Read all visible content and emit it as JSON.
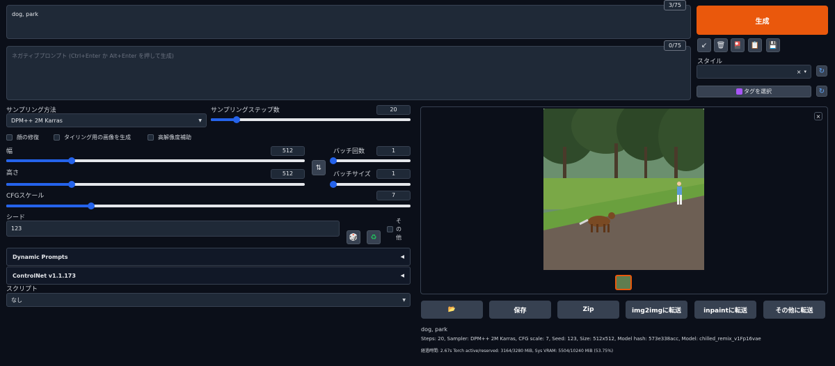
{
  "prompt": {
    "value": "dog, park",
    "counter": "3/75"
  },
  "negative_prompt": {
    "placeholder": "ネガティブプロンプト (Ctrl+Enter か Alt+Enter を押して生成)",
    "counter": "0/75"
  },
  "generate": {
    "label": "生成"
  },
  "tools": {
    "icons": [
      "arrow-down-left-icon",
      "trash-icon",
      "red-flag-icon",
      "clipboard-icon",
      "save-icon"
    ],
    "glyphs": [
      "↙",
      "🗑",
      "🎴",
      "📋",
      "💾"
    ]
  },
  "style": {
    "label": "スタイル",
    "clear": "×",
    "arrow": "▾",
    "refresh": "↻"
  },
  "tag_select": {
    "label": "タグを選択",
    "refresh": "↻"
  },
  "sampling": {
    "method_label": "サンプリング方法",
    "method_value": "DPM++ 2M Karras",
    "steps_label": "サンプリングステップ数",
    "steps_value": "20",
    "steps_frac": 0.13
  },
  "checkboxes": {
    "face_fix": "顔の修復",
    "tiling": "タイリング用の画像を生成",
    "hires": "高解像度補助"
  },
  "width": {
    "label": "幅",
    "value": "512",
    "frac": 0.22
  },
  "height": {
    "label": "高さ",
    "value": "512",
    "frac": 0.22
  },
  "swap": {
    "glyph": "⇅"
  },
  "batch_count": {
    "label": "バッチ回数",
    "value": "1",
    "frac": 0.0
  },
  "batch_size": {
    "label": "バッチサイズ",
    "value": "1",
    "frac": 0.0
  },
  "cfg": {
    "label": "CFGスケール",
    "value": "7",
    "frac": 0.21
  },
  "seed": {
    "label": "シード",
    "value": "123",
    "dice": "🎲",
    "recycle": "♻",
    "other_label": "その他"
  },
  "accordions": {
    "dynamic_prompts": "Dynamic Prompts",
    "controlnet": "ControlNet v1.1.173",
    "tri": "◀"
  },
  "script": {
    "label": "スクリプト",
    "value": "なし"
  },
  "output": {
    "close": "×",
    "buttons": {
      "folder": "📂",
      "save": "保存",
      "zip": "Zip",
      "img2img": "img2imgに転送",
      "inpaint": "inpaintに転送",
      "other": "その他に転送"
    },
    "info_prompt": "dog, park",
    "info_params": "Steps: 20, Sampler: DPM++ 2M Karras, CFG scale: 7, Seed: 123, Size: 512x512, Model hash: 573e338acc, Model: chilled_remix_v1Fp16vae",
    "info_time": "経過時間: 2.67s Torch active/reserved: 3164/3280 MiB, Sys VRAM: 5504/10240 MiB (53.75%)"
  }
}
